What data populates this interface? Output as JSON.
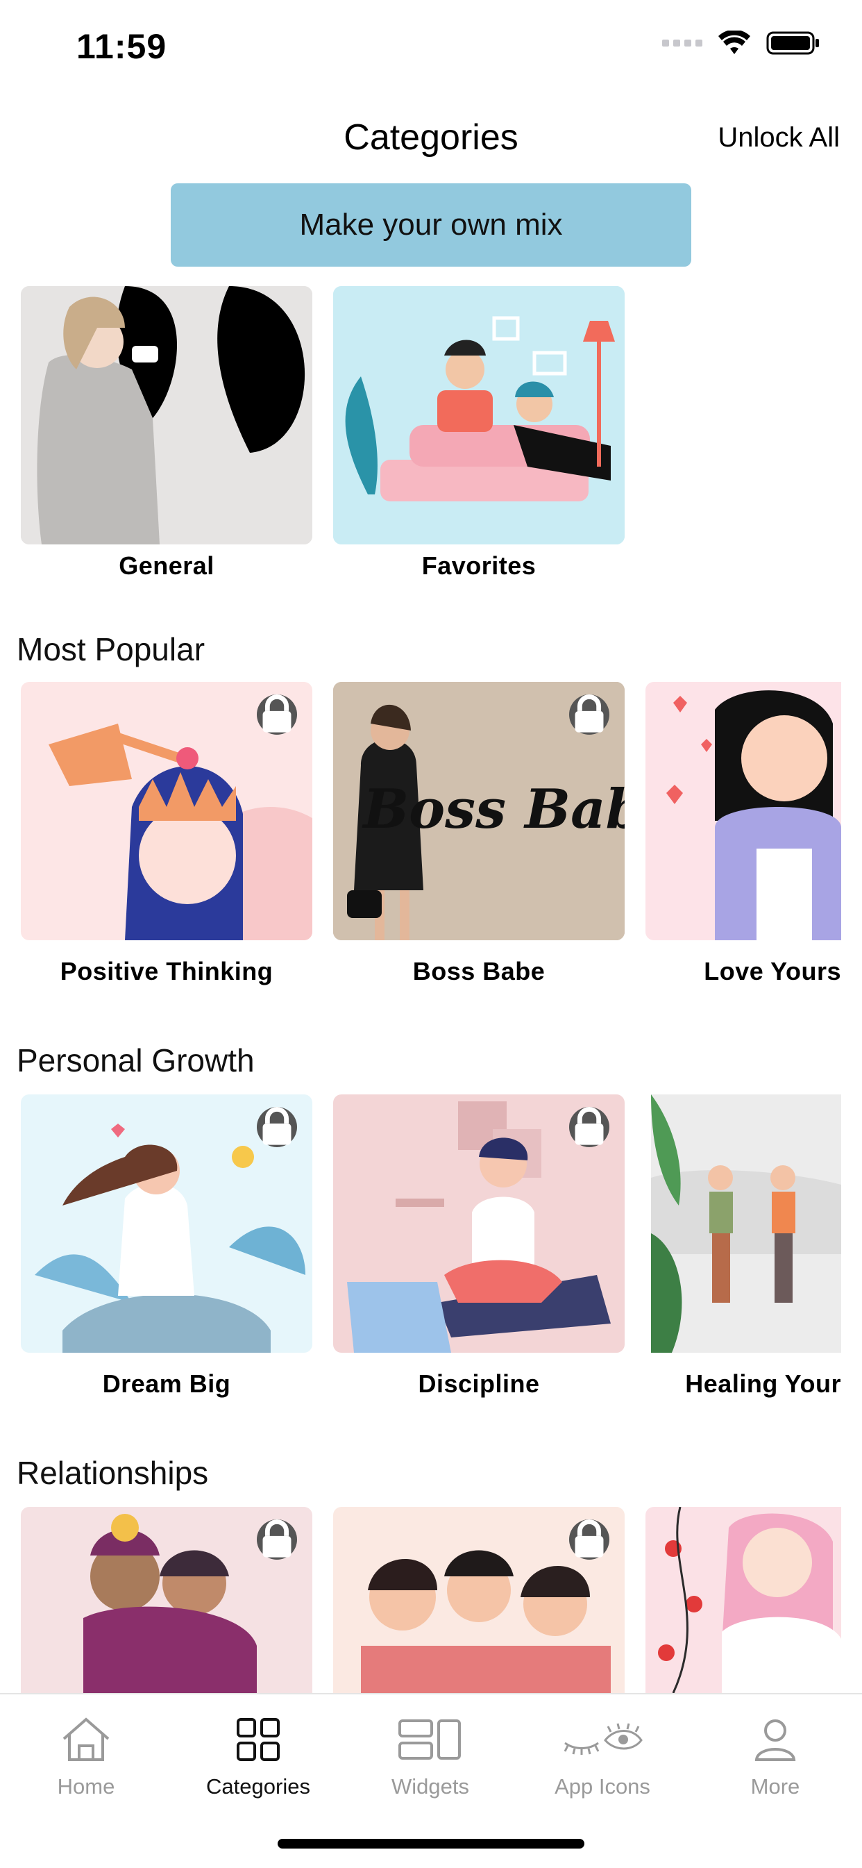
{
  "status": {
    "time": "11:59"
  },
  "header": {
    "title": "Categories",
    "unlock_label": "Unlock All"
  },
  "mix_button": {
    "label": "Make your own mix"
  },
  "top_cards": [
    {
      "label": "General"
    },
    {
      "label": "Favorites"
    }
  ],
  "sections": [
    {
      "title": "Most Popular",
      "cards": [
        {
          "label": "Positive Thinking"
        },
        {
          "label": "Boss Babe",
          "image_text": "Boss Babe"
        },
        {
          "label": "Love Yours"
        }
      ]
    },
    {
      "title": "Personal Growth",
      "cards": [
        {
          "label": "Dream Big"
        },
        {
          "label": "Discipline"
        },
        {
          "label": "Healing Your"
        }
      ]
    },
    {
      "title": "Relationships",
      "cards": [
        {
          "label": ""
        },
        {
          "label": ""
        },
        {
          "label": ""
        }
      ]
    }
  ],
  "tabs": [
    {
      "label": "Home",
      "icon": "home-icon"
    },
    {
      "label": "Categories",
      "icon": "grid-icon"
    },
    {
      "label": "Widgets",
      "icon": "widgets-icon"
    },
    {
      "label": "App Icons",
      "icon": "eye-lash-icon"
    },
    {
      "label": "More",
      "icon": "person-icon"
    }
  ],
  "colors": {
    "accent_button": "#92c9de",
    "active_tab": "#111111",
    "inactive_tab": "#9a9a9a"
  }
}
